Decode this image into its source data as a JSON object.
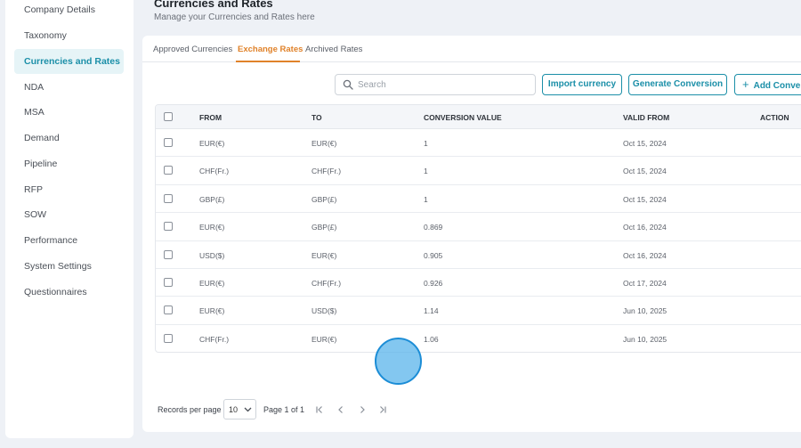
{
  "sidebar": {
    "items": [
      {
        "label": "Company Details"
      },
      {
        "label": "Taxonomy"
      },
      {
        "label": "Currencies and Rates"
      },
      {
        "label": "NDA"
      },
      {
        "label": "MSA"
      },
      {
        "label": "Demand"
      },
      {
        "label": "Pipeline"
      },
      {
        "label": "RFP"
      },
      {
        "label": "SOW"
      },
      {
        "label": "Performance"
      },
      {
        "label": "System Settings"
      },
      {
        "label": "Questionnaires"
      }
    ],
    "active": "Currencies and Rates"
  },
  "header": {
    "title": "Currencies and Rates",
    "subtitle": "Manage your Currencies and Rates here"
  },
  "tabs": [
    {
      "label": "Approved Currencies"
    },
    {
      "label": "Exchange Rates"
    },
    {
      "label": "Archived Rates"
    }
  ],
  "active_tab": "Exchange Rates",
  "toolbar": {
    "search_placeholder": "Search",
    "import_label": "Import currency",
    "generate_label": "Generate Conversion",
    "add_label": "Add Conve"
  },
  "table": {
    "headers": {
      "from": "FROM",
      "to": "TO",
      "value": "CONVERSION VALUE",
      "valid_from": "VALID FROM",
      "action": "ACTION"
    },
    "rows": [
      {
        "from": "EUR(€)",
        "to": "EUR(€)",
        "value": "1",
        "valid_from": "Oct 15, 2024"
      },
      {
        "from": "CHF(Fr.)",
        "to": "CHF(Fr.)",
        "value": "1",
        "valid_from": "Oct 15, 2024"
      },
      {
        "from": "GBP(£)",
        "to": "GBP(£)",
        "value": "1",
        "valid_from": "Oct 15, 2024"
      },
      {
        "from": "EUR(€)",
        "to": "GBP(£)",
        "value": "0.869",
        "valid_from": "Oct 16, 2024"
      },
      {
        "from": "USD($)",
        "to": "EUR(€)",
        "value": "0.905",
        "valid_from": "Oct 16, 2024"
      },
      {
        "from": "EUR(€)",
        "to": "CHF(Fr.)",
        "value": "0.926",
        "valid_from": "Oct 17, 2024"
      },
      {
        "from": "EUR(€)",
        "to": "USD($)",
        "value": "1.14",
        "valid_from": "Jun 10, 2025"
      },
      {
        "from": "CHF(Fr.)",
        "to": "EUR(€)",
        "value": "1.06",
        "valid_from": "Jun 10, 2025"
      }
    ]
  },
  "pagination": {
    "records_label": "Records per page",
    "per_page": "10",
    "page_info": "Page 1 of 1"
  },
  "colors": {
    "accent": "#1b8fa8",
    "active_tab": "#e0822a",
    "click_indicator": "#5ab4eb"
  }
}
